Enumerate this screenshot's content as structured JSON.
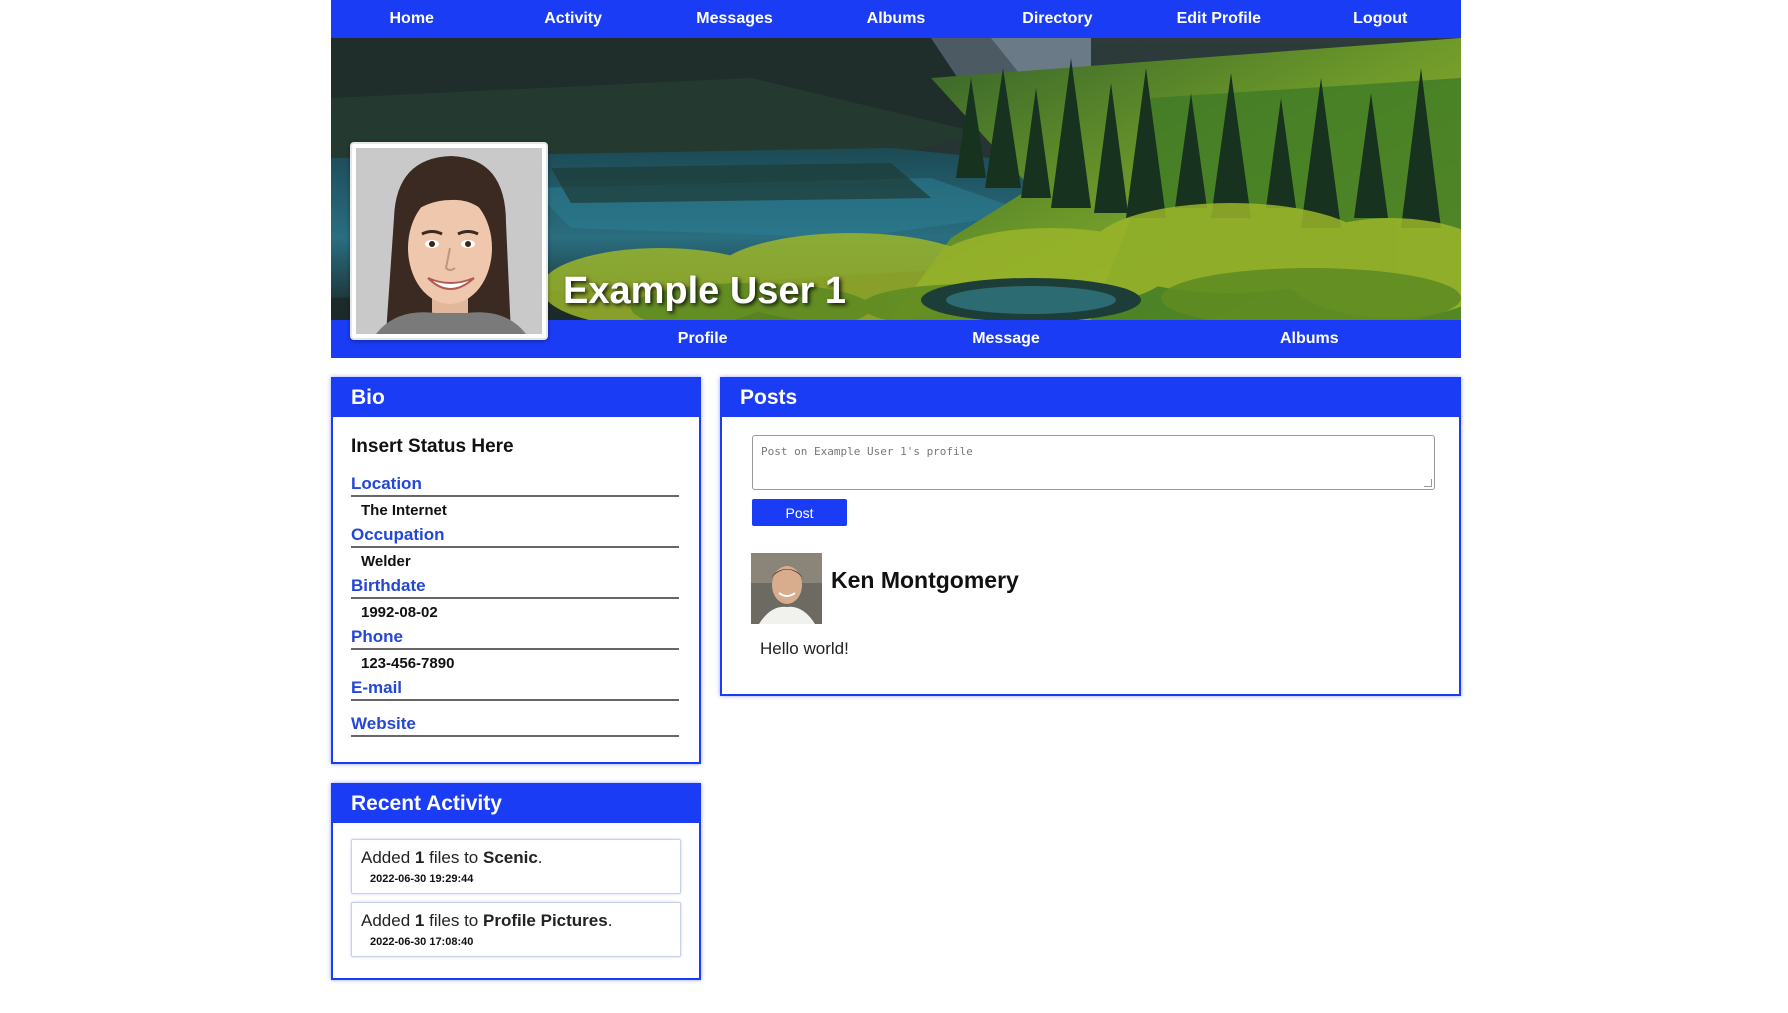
{
  "topnav": {
    "items": [
      "Home",
      "Activity",
      "Messages",
      "Albums",
      "Directory",
      "Edit Profile",
      "Logout"
    ]
  },
  "profile": {
    "name": "Example User 1",
    "tabs": [
      "Profile",
      "Message",
      "Albums"
    ]
  },
  "bio": {
    "title": "Bio",
    "status": "Insert Status Here",
    "fields": [
      {
        "label": "Location",
        "value": "The Internet"
      },
      {
        "label": "Occupation",
        "value": "Welder"
      },
      {
        "label": "Birthdate",
        "value": "1992-08-02"
      },
      {
        "label": "Phone",
        "value": "123-456-7890"
      },
      {
        "label": "E-mail",
        "value": ""
      },
      {
        "label": "Website",
        "value": ""
      }
    ]
  },
  "recent": {
    "title": "Recent Activity",
    "items": [
      {
        "prefix": "Added",
        "count": "1",
        "middle": "files to",
        "album": "Scenic",
        "suffix": ".",
        "timestamp": "2022-06-30 19:29:44"
      },
      {
        "prefix": "Added",
        "count": "1",
        "middle": "files to",
        "album": "Profile Pictures",
        "suffix": ".",
        "timestamp": "2022-06-30 17:08:40"
      }
    ]
  },
  "posts": {
    "title": "Posts",
    "composer_placeholder": "Post on Example User 1's profile",
    "post_button": "Post",
    "items": [
      {
        "author": "Ken Montgomery",
        "body": "Hello world!"
      }
    ]
  },
  "colors": {
    "accent": "#1a3cf5",
    "field_label": "#2347d6"
  }
}
